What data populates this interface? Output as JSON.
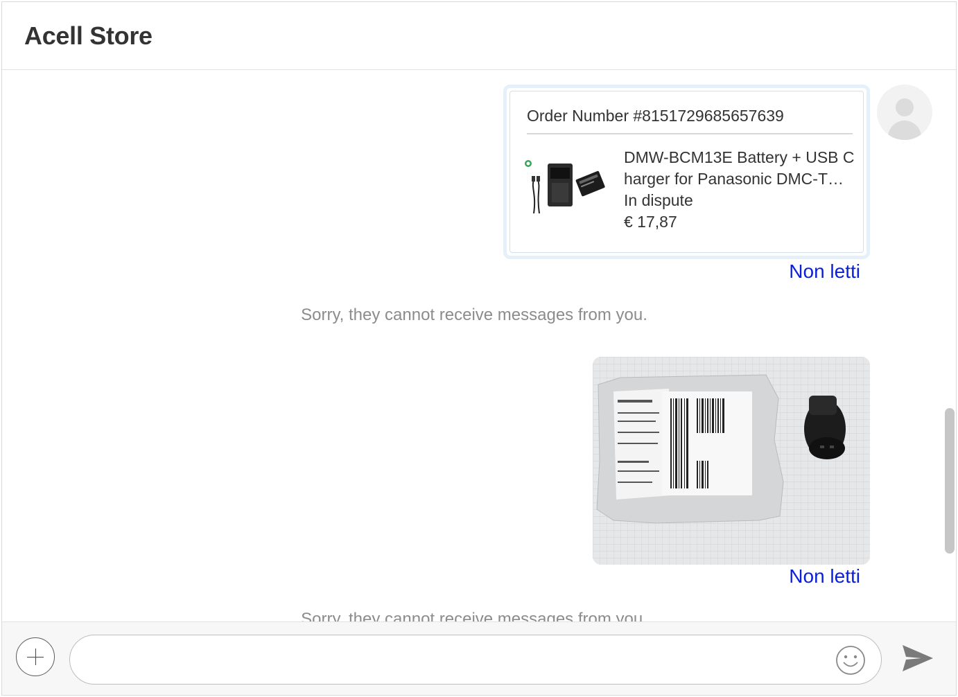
{
  "header": {
    "title": "Acell Store"
  },
  "messages": {
    "order_card": {
      "order_number": "Order Number #8151729685657639",
      "product_name": "DMW-BCM13E Battery + USB Charger for Panasonic DMC-T…",
      "status": "In dispute",
      "price": "€ 17,87"
    },
    "read_status_1": "Non letti",
    "system_notice_1": "Sorry, they cannot receive messages from you.",
    "read_status_2": "Non letti",
    "system_notice_2": "Sorry, they cannot receive messages from you."
  },
  "composer": {
    "placeholder": "",
    "value": ""
  },
  "icons": {
    "add": "plus-icon",
    "emoji": "smiley-icon",
    "send": "paper-plane-icon",
    "avatar": "user-avatar-icon"
  },
  "colors": {
    "link": "#0a1fd6",
    "system_text": "#8c8c8c",
    "card_border": "#e6f0fb"
  }
}
